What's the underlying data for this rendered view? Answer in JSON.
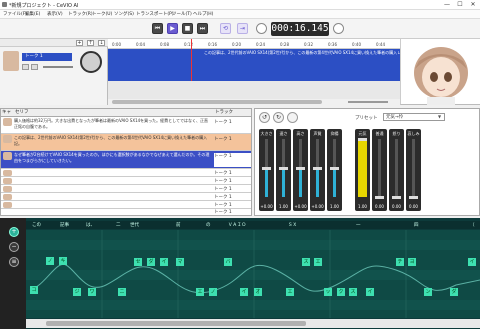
{
  "window": {
    "title": "*新規プロジェクト - CeVIO AI",
    "min": "—",
    "max": "☐",
    "close": "✕"
  },
  "menu": [
    "ファイル(F)",
    "編集(E)",
    "表示(V)",
    "トラック(R)",
    "トーク(U)",
    "ソング(S)",
    "トランスポート(P)",
    "ツール(T)",
    "ヘルプ(H)"
  ],
  "toolbar": {
    "time": "000:16.145",
    "add": "+",
    "up": "↑",
    "down": "↓"
  },
  "ruler": [
    "0:00",
    "0:04",
    "0:08",
    "0:12",
    "0:16",
    "0:20",
    "0:24",
    "0:28",
    "0:32",
    "0:36",
    "0:40",
    "0:44"
  ],
  "track": {
    "name": "トーク 1",
    "clip_text": "この記事は、2世代前のVAIO SX14(第2世代)から、この最新の第4世代VAIO SX14に買い換えた筆者の購入レビュー…"
  },
  "table": {
    "headers": {
      "cast": "キャ",
      "serif": "セリフ",
      "track": "トラック"
    },
    "rows": [
      {
        "text": "購入価格は約32万円。大きな出費となったが筆者は最新のVAIO SX14を買った。経費としてではなく、正直正銘の自腹である。",
        "track": "トーク 1",
        "state": "normal"
      },
      {
        "text": "この記事は、2世代前のVAIO SX14(第2世代)から、この最新の第4世代VAIO SX14に買い換えた筆者の購入記。",
        "track": "トーク 1",
        "state": "orange"
      },
      {
        "text": "なぜ筆者が2台続けてVAIO SX14を買ったのか。ほかにも選択肢があるなかでなぜあえて選んだのか。その理由をつまびらかにしていきたい。",
        "track": "トーク 1",
        "state": "blue"
      },
      {
        "text": "",
        "track": "トーク 1",
        "state": "normal"
      },
      {
        "text": "",
        "track": "トーク 1",
        "state": "normal"
      },
      {
        "text": "",
        "track": "トーク 1",
        "state": "normal"
      },
      {
        "text": "",
        "track": "トーク 1",
        "state": "normal"
      },
      {
        "text": "",
        "track": "トーク 1",
        "state": "normal"
      },
      {
        "text": "",
        "track": "トーク 1",
        "state": "normal"
      }
    ]
  },
  "params": {
    "preset_label": "プリセット",
    "preset_value": "元気→怜",
    "sliders": [
      {
        "label": "大きさ",
        "value": "+0.00",
        "level": 0.5
      },
      {
        "label": "速さ",
        "value": "1.00",
        "level": 0.5
      },
      {
        "label": "高さ",
        "value": "+0.00",
        "level": 0.5
      },
      {
        "label": "声質",
        "value": "+0.00",
        "level": 0.5
      },
      {
        "label": "抑揚",
        "value": "1.00",
        "level": 0.5
      }
    ],
    "emotions": [
      {
        "label": "元気",
        "value": "1.00",
        "level": 1.0
      },
      {
        "label": "普通",
        "value": "0.00",
        "level": 0.0
      },
      {
        "label": "怒り",
        "value": "0.00",
        "level": 0.0
      },
      {
        "label": "哀しみ",
        "value": "0.00",
        "level": 0.0
      }
    ]
  },
  "piano": {
    "lyrics": [
      "この",
      "記事",
      "は、",
      "二",
      "世代",
      "前",
      "の",
      "ＶＡＩＯ",
      "ＳＸ",
      "一",
      "四",
      "（"
    ],
    "notes": [
      "コ",
      "ノ",
      "キ",
      "ジ",
      "ワ",
      "ニ",
      "セ",
      "ダ",
      "イ",
      "マ",
      "エ",
      "ノ",
      "バ",
      "イ",
      "オ",
      "エ",
      "ス",
      "エ",
      "ッ",
      "ク",
      "ス",
      "イ",
      "チ",
      "ヨ",
      "ン",
      "ダ",
      "イ"
    ]
  }
}
